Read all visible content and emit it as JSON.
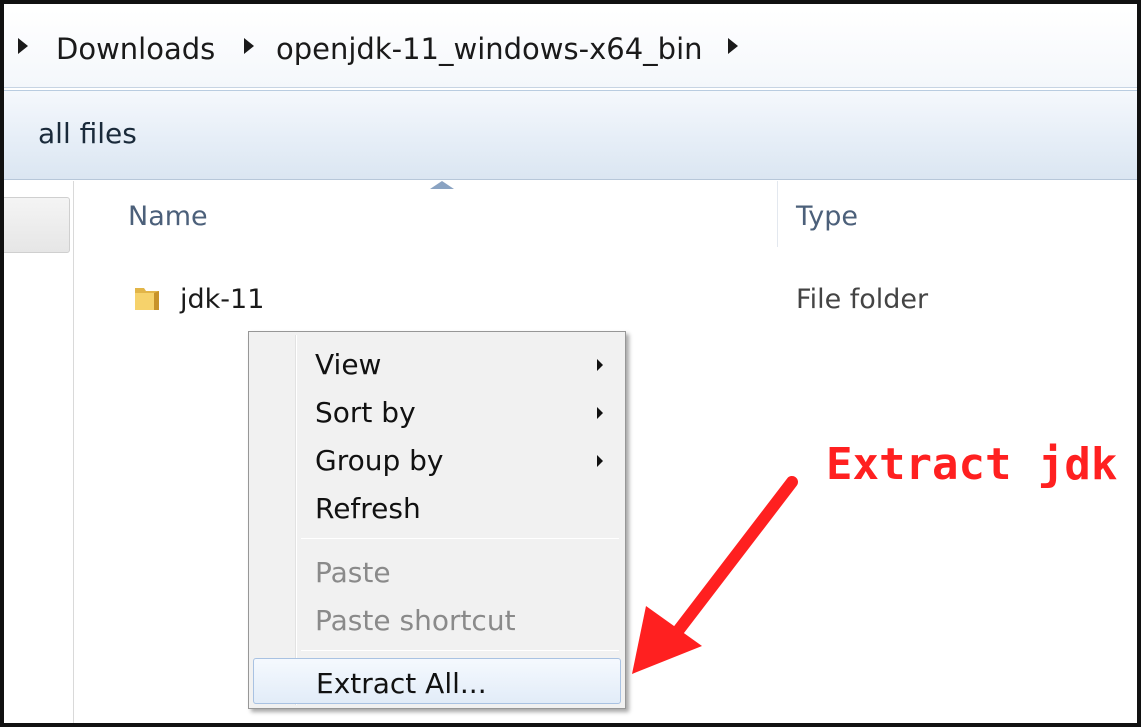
{
  "breadcrumb": {
    "items": [
      "Downloads",
      "openjdk-11_windows-x64_bin"
    ]
  },
  "toolbar": {
    "label": "all files"
  },
  "columns": {
    "name": "Name",
    "type": "Type"
  },
  "files": [
    {
      "name": "jdk-11",
      "type": "File folder",
      "icon": "folder-icon"
    }
  ],
  "context_menu": {
    "items": [
      {
        "label": "View",
        "submenu": true,
        "enabled": true
      },
      {
        "label": "Sort by",
        "submenu": true,
        "enabled": true
      },
      {
        "label": "Group by",
        "submenu": true,
        "enabled": true
      },
      {
        "label": "Refresh",
        "submenu": false,
        "enabled": true
      },
      {
        "label": "Paste",
        "submenu": false,
        "enabled": false
      },
      {
        "label": "Paste shortcut",
        "submenu": false,
        "enabled": false
      },
      {
        "label": "Extract All...",
        "submenu": false,
        "enabled": true,
        "highlighted": true
      }
    ]
  },
  "annotation": {
    "text": "Extract jdk",
    "color": "#ff2020"
  }
}
